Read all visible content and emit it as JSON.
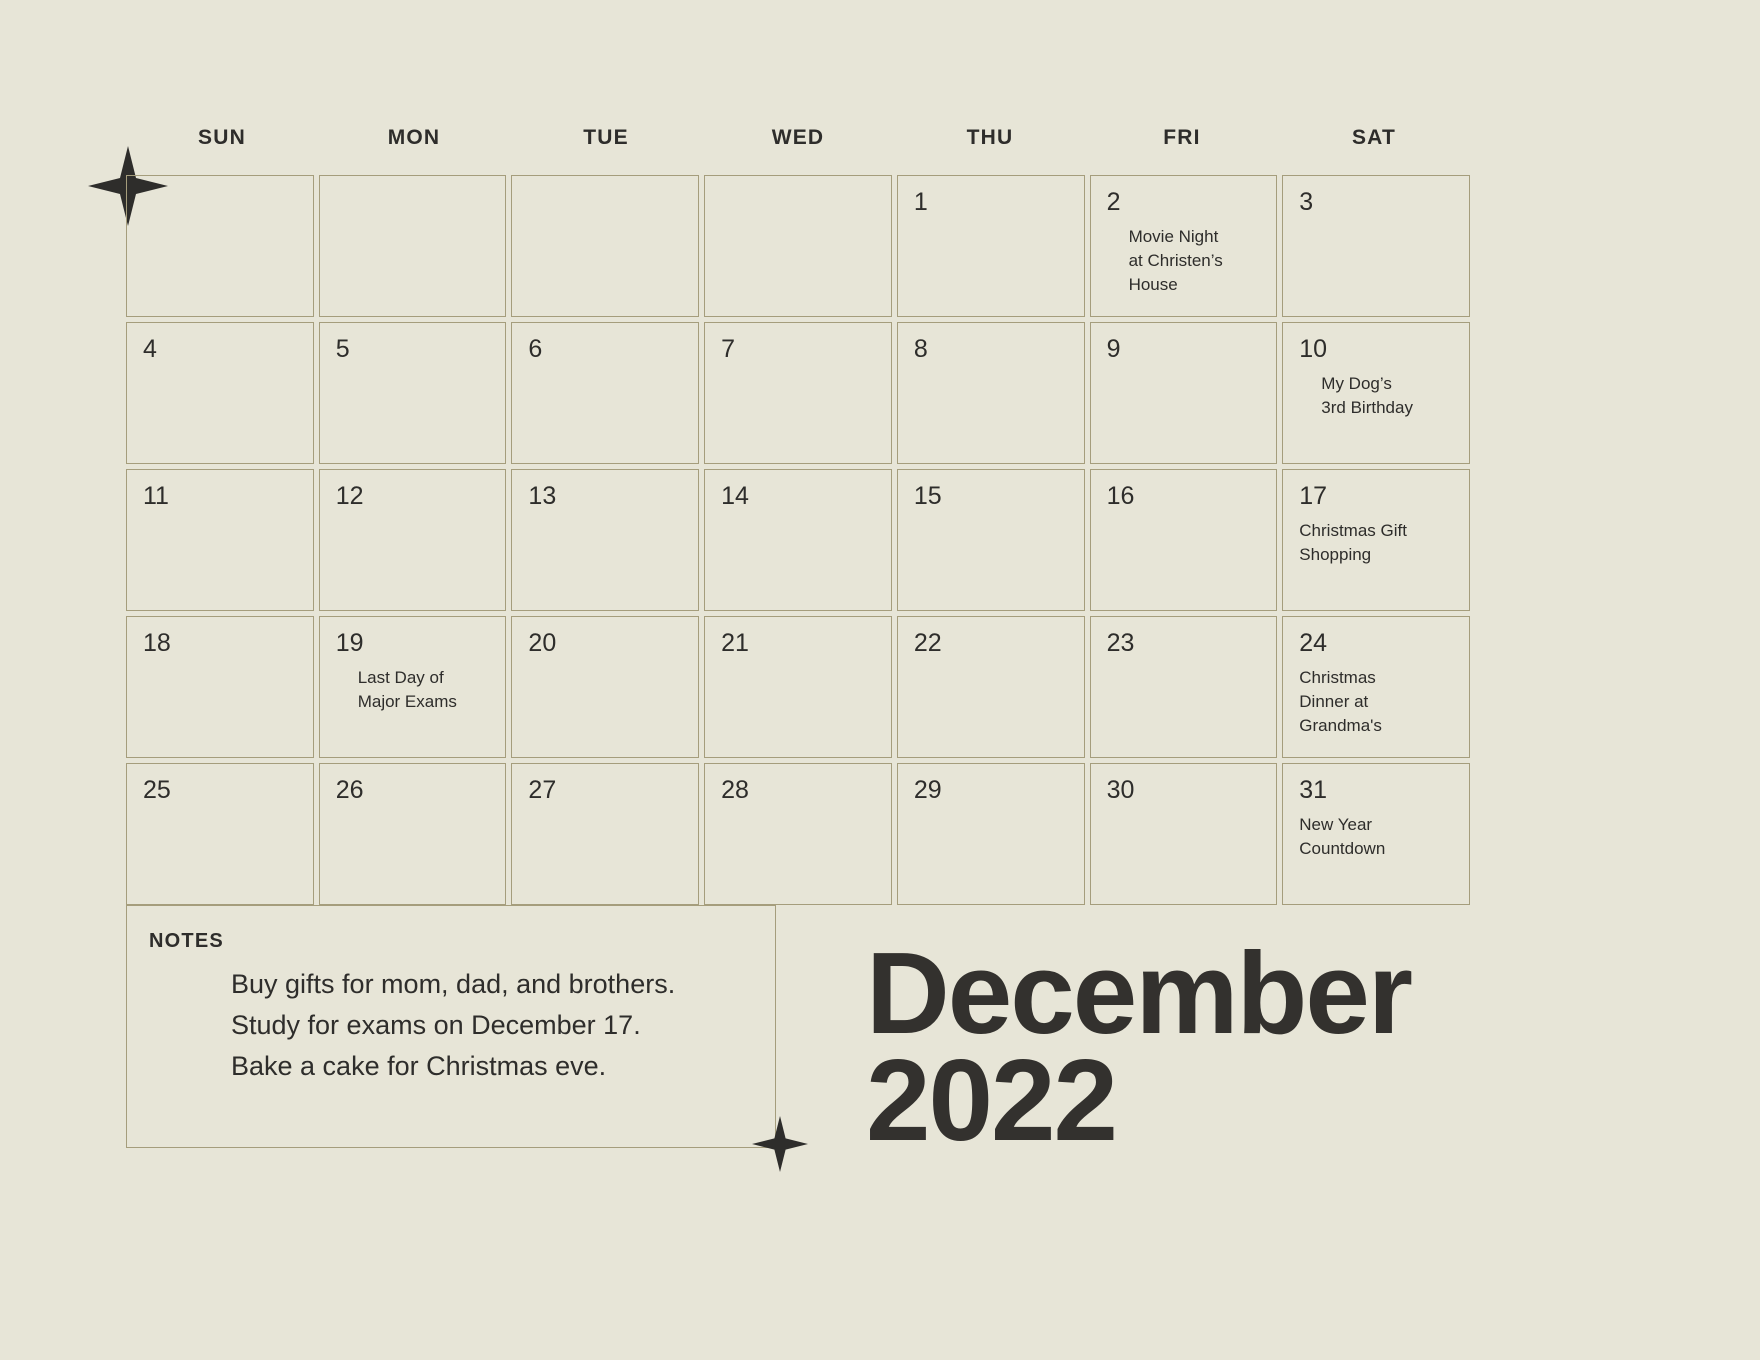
{
  "background_color": "#e7e5d7",
  "border_color": "#a59d7c",
  "text_color": "#2e2d2b",
  "header": {
    "day_labels": [
      "SUN",
      "MON",
      "TUE",
      "WED",
      "THU",
      "FRI",
      "SAT"
    ]
  },
  "title": {
    "month": "December",
    "year": "2022"
  },
  "notes": {
    "label": "NOTES",
    "body": "Buy gifts for mom, dad, and brothers.\nStudy for exams on December 17.\nBake a cake for  Christmas eve."
  },
  "calendar": {
    "weeks": [
      [
        {
          "day": "",
          "event": ""
        },
        {
          "day": "",
          "event": ""
        },
        {
          "day": "",
          "event": ""
        },
        {
          "day": "",
          "event": ""
        },
        {
          "day": "1",
          "event": ""
        },
        {
          "day": "2",
          "event": "Movie Night\nat Christen’s\nHouse"
        },
        {
          "day": "3",
          "event": ""
        }
      ],
      [
        {
          "day": "4",
          "event": ""
        },
        {
          "day": "5",
          "event": ""
        },
        {
          "day": "6",
          "event": ""
        },
        {
          "day": "7",
          "event": ""
        },
        {
          "day": "8",
          "event": ""
        },
        {
          "day": "9",
          "event": ""
        },
        {
          "day": "10",
          "event": "My Dog’s\n3rd Birthday"
        }
      ],
      [
        {
          "day": "11",
          "event": ""
        },
        {
          "day": "12",
          "event": ""
        },
        {
          "day": "13",
          "event": ""
        },
        {
          "day": "14",
          "event": ""
        },
        {
          "day": "15",
          "event": ""
        },
        {
          "day": "16",
          "event": ""
        },
        {
          "day": "17",
          "event": "Christmas Gift\nShopping"
        }
      ],
      [
        {
          "day": "18",
          "event": ""
        },
        {
          "day": "19",
          "event": "Last Day of\nMajor Exams"
        },
        {
          "day": "20",
          "event": ""
        },
        {
          "day": "21",
          "event": ""
        },
        {
          "day": "22",
          "event": ""
        },
        {
          "day": "23",
          "event": ""
        },
        {
          "day": "24",
          "event": "Christmas\nDinner at\nGrandma's"
        }
      ],
      [
        {
          "day": "25",
          "event": ""
        },
        {
          "day": "26",
          "event": ""
        },
        {
          "day": "27",
          "event": ""
        },
        {
          "day": "28",
          "event": ""
        },
        {
          "day": "29",
          "event": ""
        },
        {
          "day": "30",
          "event": ""
        },
        {
          "day": "31",
          "event": "New Year\nCountdown"
        }
      ]
    ]
  },
  "decorations": {
    "star_top_left": "four-point-star",
    "star_bottom": "four-point-star"
  }
}
